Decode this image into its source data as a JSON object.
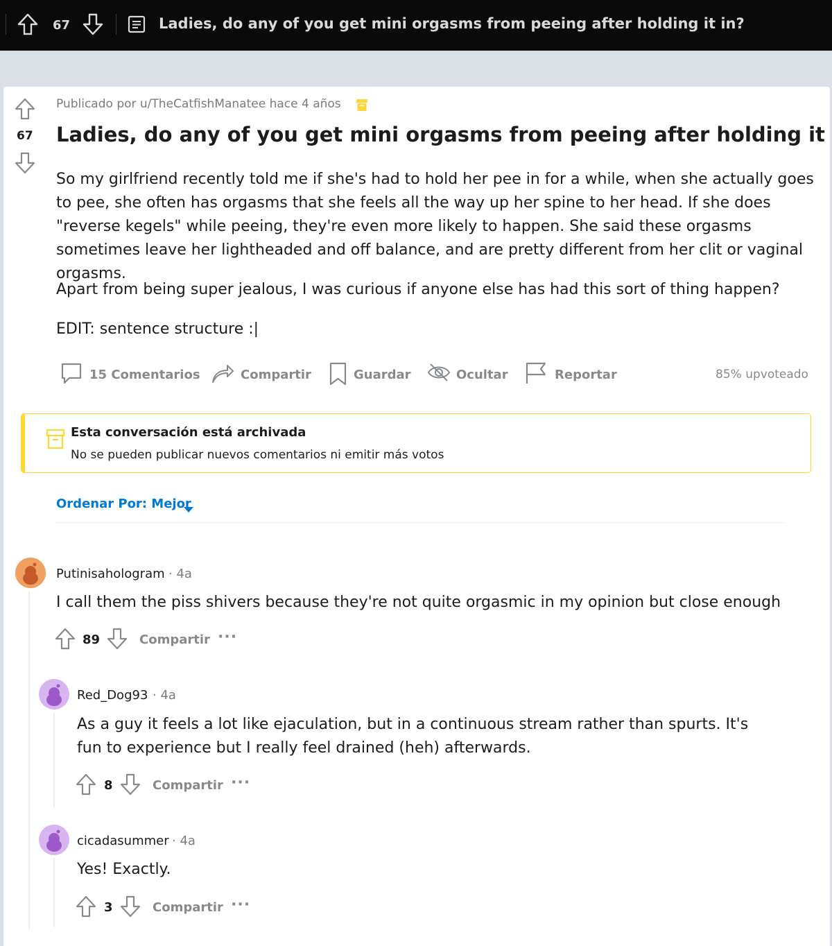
{
  "topbar": {
    "score": "67",
    "title": "Ladies, do any of you get mini orgasms from peeing after holding it in?"
  },
  "post": {
    "score": "67",
    "meta": "Publicado por u/TheCatfishManatee hace 4 años",
    "title": "Ladies, do any of you get mini orgasms from peeing after holding it in?",
    "paragraphs": [
      "So my girlfriend recently told me if she's had to hold her pee in for a while, when she actually goes to pee, she often has orgasms that she feels all the way up her spine to her head. If she does \"reverse kegels\" while peeing, they're even more likely to happen. She said these orgasms sometimes leave her lightheaded and off balance, and are pretty different from her clit or vaginal orgasms.",
      "Apart from being super jealous, I was curious if anyone else has had this sort of thing happen?",
      "EDIT: sentence structure :|"
    ],
    "actions": {
      "comments": "15 Comentarios",
      "share": "Compartir",
      "save": "Guardar",
      "hide": "Ocultar",
      "report": "Reportar"
    },
    "upvote_ratio": "85% upvoteado"
  },
  "archived": {
    "title": "Esta conversación está archivada",
    "subtitle": "No se pueden publicar nuevos comentarios ni emitir más votos"
  },
  "sort": {
    "label": "Ordenar Por: Mejor"
  },
  "comments": [
    {
      "user": "Putinisahologram",
      "time": "· 4a",
      "text": "I call them the piss shivers because they're not quite orgasmic in my opinion but close enough",
      "score": "89",
      "share": "Compartir",
      "more": "···"
    },
    {
      "user": "Red_Dog93",
      "time": "· 4a",
      "text": "As a guy it feels a lot like ejaculation, but in a continuous stream rather than spurts. It's fun to experience but I really feel drained (heh) afterwards.",
      "score": "8",
      "share": "Compartir",
      "more": "···"
    },
    {
      "user": "cicadasummer",
      "time": "· 4a",
      "text": "Yes! Exactly.",
      "score": "3",
      "share": "Compartir",
      "more": "···"
    }
  ],
  "colors": {
    "topbar_bg": "#0a0a0a",
    "page_bg": "#dae0e6",
    "link_blue": "#0079d3",
    "archive_yellow": "#ffd635",
    "muted": "#878a8c"
  }
}
